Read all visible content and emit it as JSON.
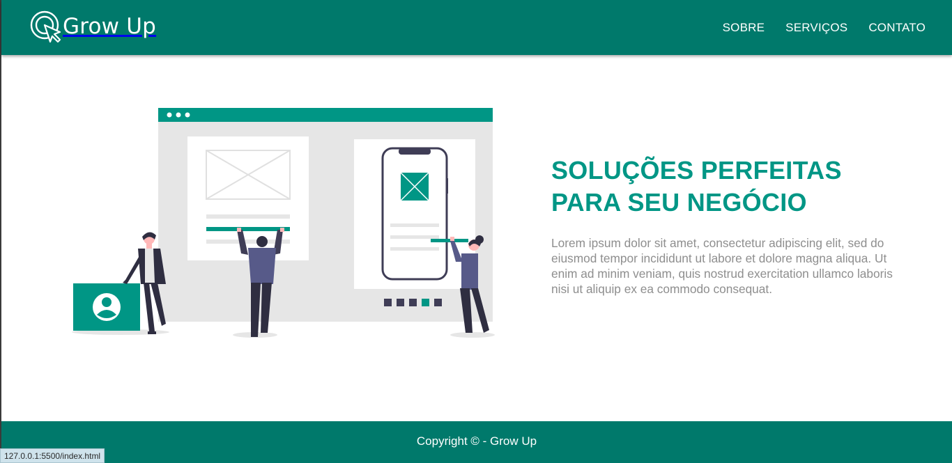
{
  "brand": {
    "name": "Grow Up",
    "logo_icon": "cursor-click-icon"
  },
  "nav": {
    "items": [
      {
        "label": "SOBRE"
      },
      {
        "label": "SERVIÇOS"
      },
      {
        "label": "CONTATO"
      }
    ]
  },
  "hero": {
    "title_line1": "SOLUÇÕES PERFEITAS",
    "title_line2": "PARA SEU NEGÓCIO",
    "body": "Lorem ipsum dolor sit amet, consectetur adipiscing elit, sed do eiusmod tempor incididunt ut labore et dolore magna aliqua. Ut enim ad minim veniam, quis nostrud exercitation ullamco laboris nisi ut aliquip ex ea commodo consequat."
  },
  "footer": {
    "copyright": "Copyright © - Grow Up"
  },
  "status_bar": {
    "url": "127.0.0.1:5500/index.html"
  },
  "colors": {
    "header_bg": "#00796b",
    "accent": "#009685",
    "body_text": "#8e8e8e",
    "footer_bg": "#00796b"
  }
}
